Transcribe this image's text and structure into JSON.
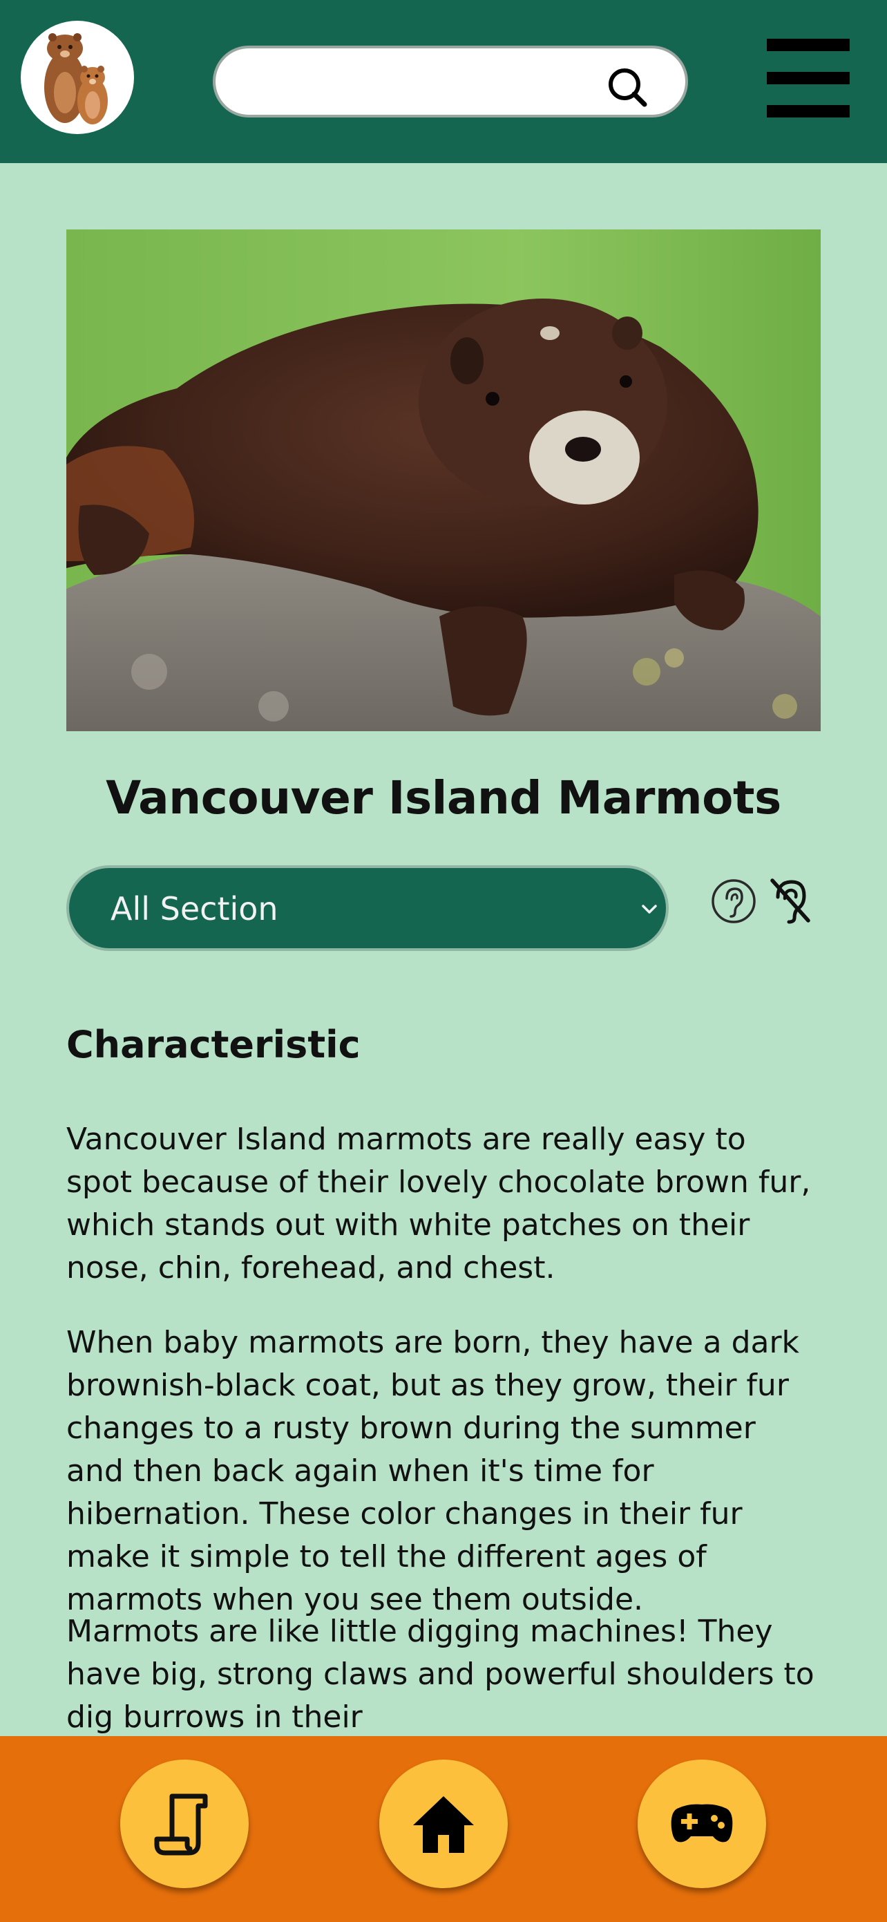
{
  "header": {
    "logo_icon": "marmot-family-logo-icon",
    "search": {
      "value": "",
      "placeholder": ""
    },
    "search_icon": "search-icon",
    "menu_icon": "hamburger-menu-icon",
    "colors": {
      "header_bg": "#146651",
      "page_bg": "#b8e2c7"
    }
  },
  "hero": {
    "image": "marmot-on-rock-photo"
  },
  "page": {
    "title": "Vancouver Island Marmots",
    "section_select": {
      "selected": "All Section"
    },
    "audio_icons": [
      "ear-listen-icon",
      "hearing-off-icon"
    ]
  },
  "article": {
    "heading": "Characteristic",
    "paragraphs": [
      "Vancouver Island marmots are really easy to spot because of their lovely chocolate brown fur, which stands out with white patches on their nose, chin, forehead, and chest.",
      "When baby marmots are born, they have a dark brownish-black coat, but as they grow, their fur changes to a rusty brown during the summer and then back again when it's time for hibernation. These color changes in their fur make it simple to tell the different ages of marmots when you see them outside.",
      "Marmots are like little digging machines! They have big, strong claws and powerful shoulders to dig burrows in their"
    ]
  },
  "bottom_nav": {
    "items": [
      "scroll-reading-icon",
      "home-icon",
      "gamepad-icon"
    ],
    "colors": {
      "bar_bg": "#e56f0b",
      "button_bg": "#fcc03c"
    }
  }
}
